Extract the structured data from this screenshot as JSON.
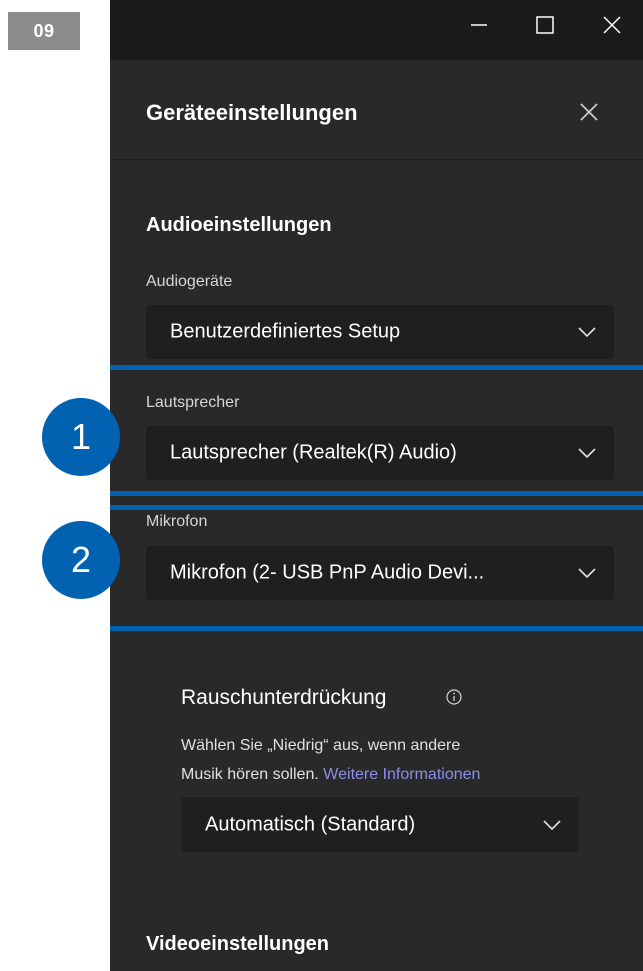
{
  "step_label": "09",
  "panel": {
    "title": "Geräteeinstellungen",
    "audio_section_title": "Audioeinstellungen",
    "audio_devices": {
      "label": "Audiogeräte",
      "value": "Benutzerdefiniertes Setup"
    },
    "speaker": {
      "label": "Lautsprecher",
      "value": "Lautsprecher (Realtek(R) Audio)"
    },
    "microphone": {
      "label": "Mikrofon",
      "value": "Mikrofon (2- USB PnP Audio Devi..."
    },
    "noise_suppression": {
      "title": "Rauschunterdrückung",
      "description_line1": "Wählen Sie „Niedrig“ aus, wenn andere",
      "description_line2": "Musik hören sollen.",
      "link": "Weitere Informationen",
      "value": "Automatisch (Standard)"
    },
    "video_section_title": "Videoeinstellungen"
  },
  "callouts": [
    "1",
    "2"
  ],
  "colors": {
    "panel_bg": "#292929",
    "dropdown_bg": "#1f1f1f",
    "titlebar_bg": "#1b1b1b",
    "highlight": "#0062b1",
    "link": "#8b8fe8"
  }
}
